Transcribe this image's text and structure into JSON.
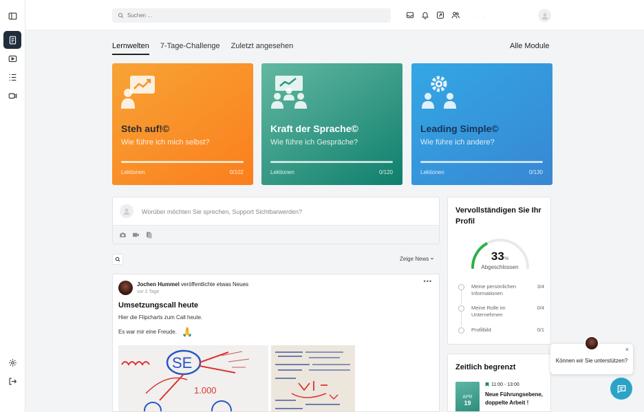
{
  "search": {
    "placeholder": "Suchen ..."
  },
  "topbar": {
    "dots": ". ."
  },
  "tabs": [
    {
      "label": "Lernwelten"
    },
    {
      "label": "7-Tage-Challenge"
    },
    {
      "label": "Zuletzt angesehen"
    }
  ],
  "all_modules": "Alle Module",
  "courses": [
    {
      "title": "Steh auf!©",
      "subtitle": "Wie führe ich mich selbst?",
      "lessons_label": "Lektionen",
      "count": "0/102",
      "progress": 0
    },
    {
      "title": "Kraft der Sprache©",
      "subtitle": "Wie führe ich Gespräche?",
      "lessons_label": "Lektionen",
      "count": "0/120",
      "progress": 0
    },
    {
      "title": "Leading Simple©",
      "subtitle": "Wie führe ich andere?",
      "lessons_label": "Lektionen",
      "count": "0/130",
      "progress": 0
    }
  ],
  "composer": {
    "placeholder": "Worüber möchten Sie sprechen, Support Sichtbarwerden?"
  },
  "feed_filter": "Zeige News",
  "post": {
    "author": "Jochen Hummel",
    "action": "veröffentlichte etwas Neues",
    "time": "vor 2 Tage",
    "more": "•••",
    "title": "Umsetzungscall heute",
    "text1": "Hier die Flipcharts zum Call heute.",
    "text2": "Es war mir eine Freude.",
    "emoji": "🙏"
  },
  "profile": {
    "title": "Vervollständigen Sie Ihr Profil",
    "percent": "33",
    "percent_unit": "%",
    "percent_value": 33,
    "done_label": "Abgeschlossen",
    "steps": [
      {
        "label": "Meine persönlichen Informationen",
        "count": "3/4"
      },
      {
        "label": "Meine Rolle im Unternehmen",
        "count": "0/4"
      },
      {
        "label": "Profilbild",
        "count": "0/1"
      }
    ]
  },
  "limited": {
    "title": "Zeitlich begrenzt",
    "month": "APR",
    "day": "19",
    "time": "11:00 - 13:00",
    "headline": "Neue Führungsebene, doppelte Arbeit !"
  },
  "chat": {
    "text": "Können wir Sie unterstützen?",
    "close": "×"
  },
  "colors": {
    "rail_active": "#1f2d3d",
    "gauge": "#2db04a",
    "chat": "#2ba3c7"
  }
}
